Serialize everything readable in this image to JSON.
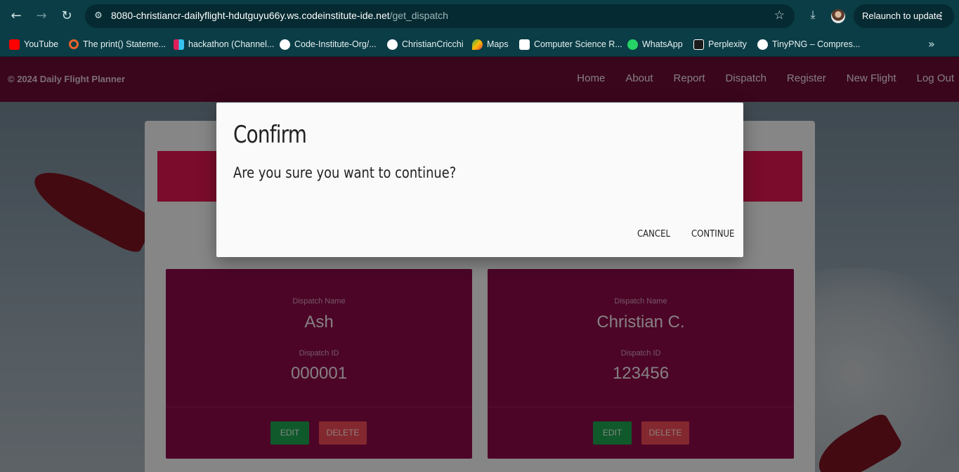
{
  "browser": {
    "url_host": "8080-christiancr-dailyflight-hdutguyu66y.ws.codeinstitute-ide.net",
    "url_path": "/get_dispatch",
    "relaunch_label": "Relaunch to update",
    "bookmarks": [
      {
        "label": "YouTube",
        "icon": "youtube-icon",
        "color": "#ff0000"
      },
      {
        "label": "The print() Stateme...",
        "icon": "ring-icon",
        "color": "#e8632b"
      },
      {
        "label": "hackathon (Channel...",
        "icon": "slack-icon",
        "color": "#e01e5a"
      },
      {
        "label": "Code-Institute-Org/...",
        "icon": "github-icon",
        "color": "#ffffff"
      },
      {
        "label": "ChristianCricchi",
        "icon": "github-icon",
        "color": "#ffffff"
      },
      {
        "label": "Maps",
        "icon": "maps-icon",
        "color": "#34a853"
      },
      {
        "label": "Computer Science R...",
        "icon": "r-icon",
        "color": "#ffffff"
      },
      {
        "label": "WhatsApp",
        "icon": "whatsapp-icon",
        "color": "#25d366"
      },
      {
        "label": "Perplexity",
        "icon": "perplexity-icon",
        "color": "#ffffff"
      },
      {
        "label": "TinyPNG – Compres...",
        "icon": "panda-icon",
        "color": "#ffffff"
      }
    ]
  },
  "site": {
    "brand": "© 2024 Daily Flight Planner",
    "nav": [
      "Home",
      "About",
      "Report",
      "Dispatch",
      "Register",
      "New Flight",
      "Log Out"
    ]
  },
  "dispatch_cards": [
    {
      "name_label": "Dispatch Name",
      "name": "Ash",
      "id_label": "Dispatch ID",
      "id": "000001",
      "edit": "EDIT",
      "delete": "DELETE"
    },
    {
      "name_label": "Dispatch Name",
      "name": "Christian C.",
      "id_label": "Dispatch ID",
      "id": "123456",
      "edit": "EDIT",
      "delete": "DELETE"
    }
  ],
  "modal": {
    "title": "Confirm",
    "message": "Are you sure you want to continue?",
    "cancel": "CANCEL",
    "continue": "CONTINUE"
  },
  "colors": {
    "navbar": "#6a0c33",
    "banner": "#e0174f",
    "card": "#8a0a47",
    "edit_button": "#1ea34f",
    "delete_button": "#f04a57"
  }
}
